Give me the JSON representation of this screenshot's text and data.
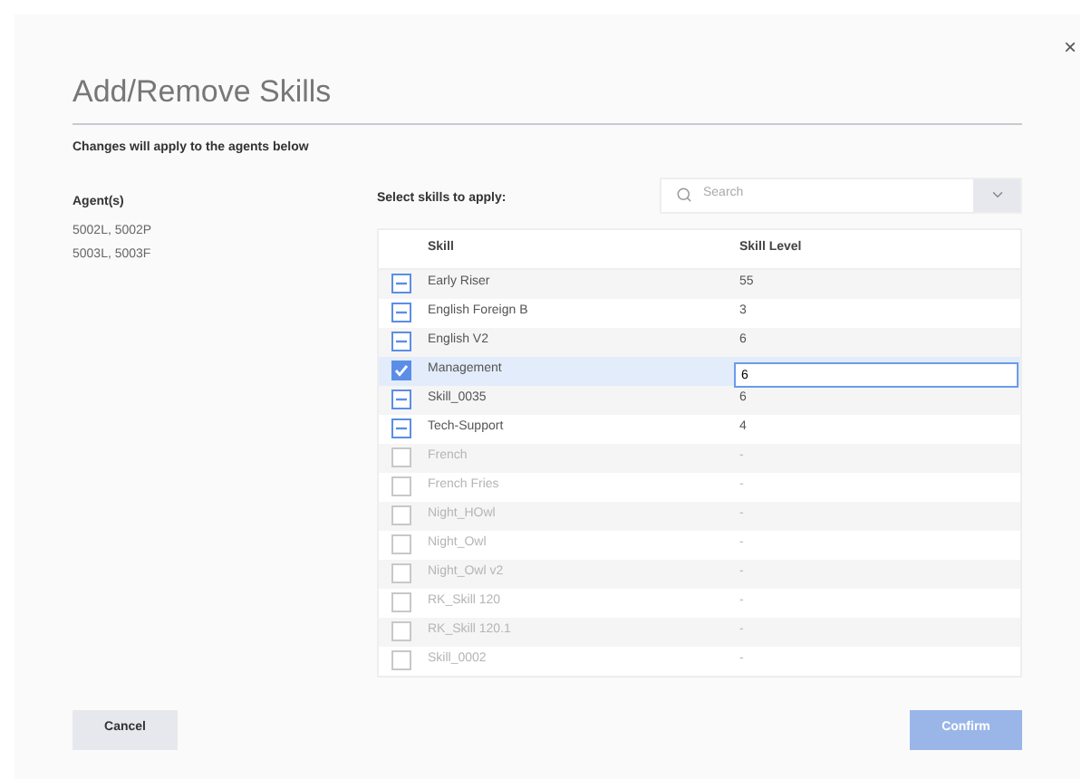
{
  "close": "×",
  "title": "Add/Remove Skills",
  "subtitle": "Changes will apply to the agents below",
  "agents": {
    "label": "Agent(s)",
    "lines": [
      "5002L, 5002P",
      "5003L, 5003F"
    ]
  },
  "skills": {
    "label": "Select skills to apply:",
    "search": {
      "placeholder": "Search"
    },
    "columns": [
      "Skill",
      "Skill Level"
    ],
    "rows": [
      {
        "skill": "Early Riser",
        "level": "55",
        "kind": "partial",
        "selected": false,
        "editing": false,
        "disabled": false
      },
      {
        "skill": "English Foreign B",
        "level": "3",
        "kind": "partial",
        "selected": false,
        "editing": false,
        "disabled": false
      },
      {
        "skill": "English V2",
        "level": "6",
        "kind": "partial",
        "selected": false,
        "editing": false,
        "disabled": false
      },
      {
        "skill": "Management",
        "level": "6",
        "kind": "checked",
        "selected": true,
        "editing": true,
        "disabled": false
      },
      {
        "skill": "Skill_0035",
        "level": "6",
        "kind": "partial",
        "selected": false,
        "editing": false,
        "disabled": false
      },
      {
        "skill": "Tech-Support",
        "level": "4",
        "kind": "partial",
        "selected": false,
        "editing": false,
        "disabled": false
      },
      {
        "skill": "French",
        "level": "-",
        "kind": "empty",
        "selected": false,
        "editing": false,
        "disabled": true
      },
      {
        "skill": "French Fries",
        "level": "-",
        "kind": "empty",
        "selected": false,
        "editing": false,
        "disabled": true
      },
      {
        "skill": "Night_HOwl",
        "level": "-",
        "kind": "empty",
        "selected": false,
        "editing": false,
        "disabled": true
      },
      {
        "skill": "Night_Owl",
        "level": "-",
        "kind": "empty",
        "selected": false,
        "editing": false,
        "disabled": true
      },
      {
        "skill": "Night_Owl v2",
        "level": "-",
        "kind": "empty",
        "selected": false,
        "editing": false,
        "disabled": true
      },
      {
        "skill": "RK_Skill 120",
        "level": "-",
        "kind": "empty",
        "selected": false,
        "editing": false,
        "disabled": true
      },
      {
        "skill": "RK_Skill 120.1",
        "level": "-",
        "kind": "empty",
        "selected": false,
        "editing": false,
        "disabled": true
      },
      {
        "skill": "Skill_0002",
        "level": "-",
        "kind": "empty",
        "selected": false,
        "editing": false,
        "disabled": true
      }
    ]
  },
  "buttons": {
    "cancel": "Cancel",
    "confirm": {
      "label": "Confirm",
      "disabled": true
    }
  }
}
